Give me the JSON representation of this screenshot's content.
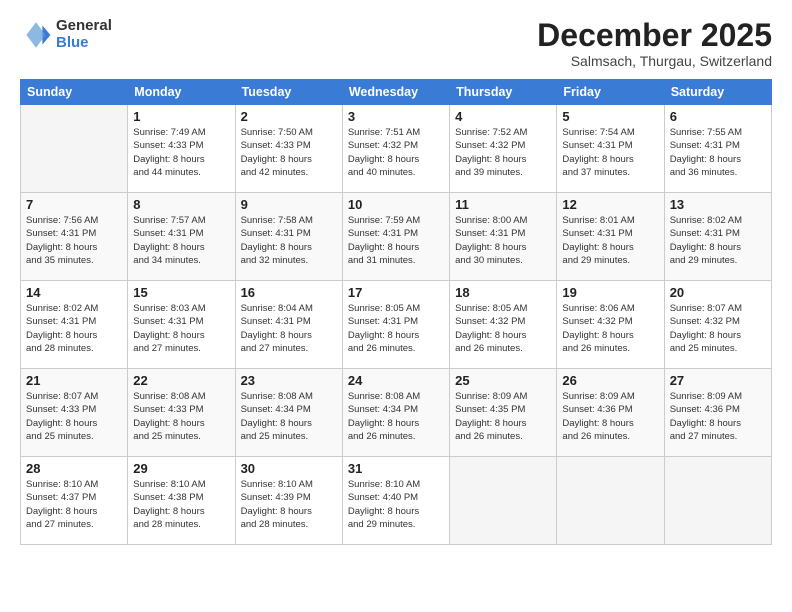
{
  "logo": {
    "general": "General",
    "blue": "Blue"
  },
  "title": {
    "month": "December 2025",
    "location": "Salmsach, Thurgau, Switzerland"
  },
  "headers": [
    "Sunday",
    "Monday",
    "Tuesday",
    "Wednesday",
    "Thursday",
    "Friday",
    "Saturday"
  ],
  "weeks": [
    [
      {
        "day": "",
        "info": ""
      },
      {
        "day": "1",
        "info": "Sunrise: 7:49 AM\nSunset: 4:33 PM\nDaylight: 8 hours\nand 44 minutes."
      },
      {
        "day": "2",
        "info": "Sunrise: 7:50 AM\nSunset: 4:33 PM\nDaylight: 8 hours\nand 42 minutes."
      },
      {
        "day": "3",
        "info": "Sunrise: 7:51 AM\nSunset: 4:32 PM\nDaylight: 8 hours\nand 40 minutes."
      },
      {
        "day": "4",
        "info": "Sunrise: 7:52 AM\nSunset: 4:32 PM\nDaylight: 8 hours\nand 39 minutes."
      },
      {
        "day": "5",
        "info": "Sunrise: 7:54 AM\nSunset: 4:31 PM\nDaylight: 8 hours\nand 37 minutes."
      },
      {
        "day": "6",
        "info": "Sunrise: 7:55 AM\nSunset: 4:31 PM\nDaylight: 8 hours\nand 36 minutes."
      }
    ],
    [
      {
        "day": "7",
        "info": "Sunrise: 7:56 AM\nSunset: 4:31 PM\nDaylight: 8 hours\nand 35 minutes."
      },
      {
        "day": "8",
        "info": "Sunrise: 7:57 AM\nSunset: 4:31 PM\nDaylight: 8 hours\nand 34 minutes."
      },
      {
        "day": "9",
        "info": "Sunrise: 7:58 AM\nSunset: 4:31 PM\nDaylight: 8 hours\nand 32 minutes."
      },
      {
        "day": "10",
        "info": "Sunrise: 7:59 AM\nSunset: 4:31 PM\nDaylight: 8 hours\nand 31 minutes."
      },
      {
        "day": "11",
        "info": "Sunrise: 8:00 AM\nSunset: 4:31 PM\nDaylight: 8 hours\nand 30 minutes."
      },
      {
        "day": "12",
        "info": "Sunrise: 8:01 AM\nSunset: 4:31 PM\nDaylight: 8 hours\nand 29 minutes."
      },
      {
        "day": "13",
        "info": "Sunrise: 8:02 AM\nSunset: 4:31 PM\nDaylight: 8 hours\nand 29 minutes."
      }
    ],
    [
      {
        "day": "14",
        "info": "Sunrise: 8:02 AM\nSunset: 4:31 PM\nDaylight: 8 hours\nand 28 minutes."
      },
      {
        "day": "15",
        "info": "Sunrise: 8:03 AM\nSunset: 4:31 PM\nDaylight: 8 hours\nand 27 minutes."
      },
      {
        "day": "16",
        "info": "Sunrise: 8:04 AM\nSunset: 4:31 PM\nDaylight: 8 hours\nand 27 minutes."
      },
      {
        "day": "17",
        "info": "Sunrise: 8:05 AM\nSunset: 4:31 PM\nDaylight: 8 hours\nand 26 minutes."
      },
      {
        "day": "18",
        "info": "Sunrise: 8:05 AM\nSunset: 4:32 PM\nDaylight: 8 hours\nand 26 minutes."
      },
      {
        "day": "19",
        "info": "Sunrise: 8:06 AM\nSunset: 4:32 PM\nDaylight: 8 hours\nand 26 minutes."
      },
      {
        "day": "20",
        "info": "Sunrise: 8:07 AM\nSunset: 4:32 PM\nDaylight: 8 hours\nand 25 minutes."
      }
    ],
    [
      {
        "day": "21",
        "info": "Sunrise: 8:07 AM\nSunset: 4:33 PM\nDaylight: 8 hours\nand 25 minutes."
      },
      {
        "day": "22",
        "info": "Sunrise: 8:08 AM\nSunset: 4:33 PM\nDaylight: 8 hours\nand 25 minutes."
      },
      {
        "day": "23",
        "info": "Sunrise: 8:08 AM\nSunset: 4:34 PM\nDaylight: 8 hours\nand 25 minutes."
      },
      {
        "day": "24",
        "info": "Sunrise: 8:08 AM\nSunset: 4:34 PM\nDaylight: 8 hours\nand 26 minutes."
      },
      {
        "day": "25",
        "info": "Sunrise: 8:09 AM\nSunset: 4:35 PM\nDaylight: 8 hours\nand 26 minutes."
      },
      {
        "day": "26",
        "info": "Sunrise: 8:09 AM\nSunset: 4:36 PM\nDaylight: 8 hours\nand 26 minutes."
      },
      {
        "day": "27",
        "info": "Sunrise: 8:09 AM\nSunset: 4:36 PM\nDaylight: 8 hours\nand 27 minutes."
      }
    ],
    [
      {
        "day": "28",
        "info": "Sunrise: 8:10 AM\nSunset: 4:37 PM\nDaylight: 8 hours\nand 27 minutes."
      },
      {
        "day": "29",
        "info": "Sunrise: 8:10 AM\nSunset: 4:38 PM\nDaylight: 8 hours\nand 28 minutes."
      },
      {
        "day": "30",
        "info": "Sunrise: 8:10 AM\nSunset: 4:39 PM\nDaylight: 8 hours\nand 28 minutes."
      },
      {
        "day": "31",
        "info": "Sunrise: 8:10 AM\nSunset: 4:40 PM\nDaylight: 8 hours\nand 29 minutes."
      },
      {
        "day": "",
        "info": ""
      },
      {
        "day": "",
        "info": ""
      },
      {
        "day": "",
        "info": ""
      }
    ]
  ]
}
